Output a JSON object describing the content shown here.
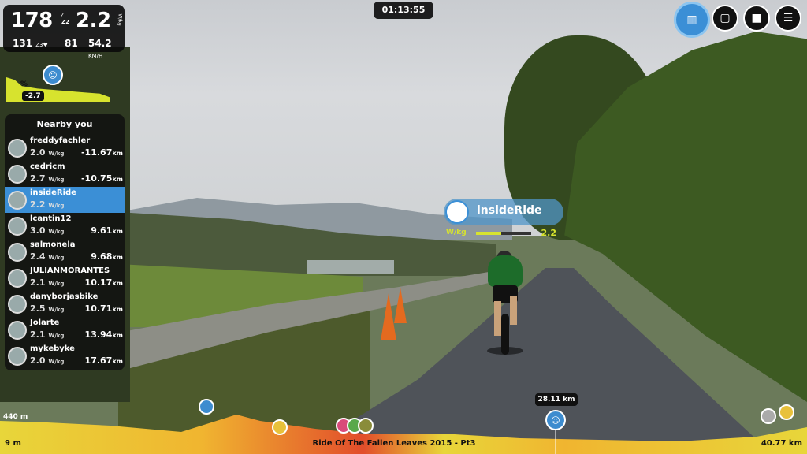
{
  "stats": {
    "power": "178",
    "power_zone": "Z2",
    "wkg": "2.2",
    "wkg_unit": "W/kg",
    "heart_rate": "131",
    "hr_zone": "Z3",
    "cadence": "81",
    "speed": "54.2",
    "speed_unit": "KM/H"
  },
  "slope": {
    "label": "%",
    "value": "-2.7"
  },
  "timer": "01:13:55",
  "nearby": {
    "title": "Nearby you",
    "wkg_unit": "W/kg",
    "dist_unit": "km",
    "riders": [
      {
        "name": "freddyfachler",
        "wkg": "2.0",
        "dist": "-11.67",
        "me": false
      },
      {
        "name": "cedricm",
        "wkg": "2.7",
        "dist": "-10.75",
        "me": false
      },
      {
        "name": "insideRide",
        "wkg": "2.2",
        "dist": "",
        "me": true
      },
      {
        "name": "lcantin12",
        "wkg": "3.0",
        "dist": "9.61",
        "me": false
      },
      {
        "name": "salmonela",
        "wkg": "2.4",
        "dist": "9.68",
        "me": false
      },
      {
        "name": "JULIANMORANTES",
        "wkg": "2.1",
        "dist": "10.17",
        "me": false
      },
      {
        "name": "danyborjasbike",
        "wkg": "2.5",
        "dist": "10.71",
        "me": false
      },
      {
        "name": "Jolarte",
        "wkg": "2.1",
        "dist": "13.94",
        "me": false
      },
      {
        "name": "mykebyke",
        "wkg": "2.0",
        "dist": "17.67",
        "me": false
      }
    ]
  },
  "rider_tag": {
    "name": "insideRide",
    "wkg_label": "W/kg",
    "wkg_value": "2.2",
    "wkg_fraction": 0.45
  },
  "progress": {
    "current_distance": "28.11 km",
    "start_label": "9 m",
    "end_label": "40.77 km",
    "elevation_label": "440 m",
    "route_name": "Ride Of The Fallen Leaves 2015 - Pt3"
  },
  "icons": {
    "map": "map-icon",
    "chat": "chat-icon",
    "stop": "stop-icon",
    "menu": "menu-icon"
  },
  "colors": {
    "accent": "#3b8fd6",
    "slope": "#d7e32e"
  }
}
